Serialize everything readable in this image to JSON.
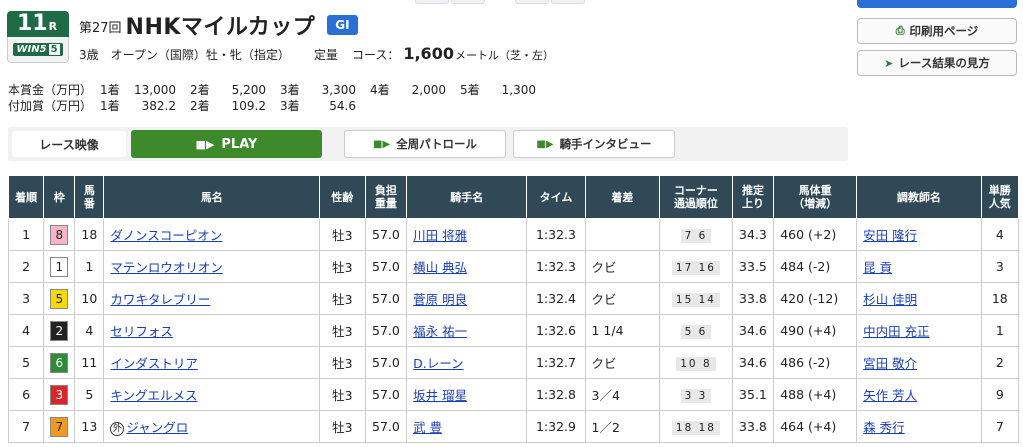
{
  "race": {
    "number": "11",
    "r_suffix": "R",
    "win5_label": "WIN",
    "win5_num": "5",
    "win5_leg": "5",
    "kai": "第27回",
    "name": "NHKマイルカップ",
    "grade": "GI",
    "conditions": "3歳　オープン（国際）牡・牝（指定）",
    "weight_rule": "定量",
    "course_label": "コース：",
    "distance": "1,600",
    "distance_unit": "メートル（芝・左）"
  },
  "buttons": {
    "print": "印刷用ページ",
    "results": "レース結果の見方",
    "print_icon": "printer-icon",
    "results_icon": "arrow-circle-icon"
  },
  "prize": {
    "main_label": "本賞金（万円）",
    "main": [
      [
        "1着",
        "13,000"
      ],
      [
        "2着",
        "5,200"
      ],
      [
        "3着",
        "3,300"
      ],
      [
        "4着",
        "2,000"
      ],
      [
        "5着",
        "1,300"
      ]
    ],
    "extra_label": "付加賞（万円）",
    "extra": [
      [
        "1着",
        "382.2"
      ],
      [
        "2着",
        "109.2"
      ],
      [
        "3着",
        "54.6"
      ]
    ]
  },
  "video": {
    "label": "レース映像",
    "play": "PLAY",
    "patrol": "全周パトロール",
    "interview": "騎手インタビュー"
  },
  "table": {
    "headers": [
      "着順",
      "枠",
      "馬番",
      "馬名",
      "性齢",
      "負担重量",
      "騎手名",
      "タイム",
      "着差",
      "コーナー通過順位",
      "推定上り",
      "馬体重（増減）",
      "調教師名",
      "単勝人気"
    ],
    "rows": [
      {
        "pos": "1",
        "waku": "8",
        "num": "18",
        "horse": "ダノンスコーピオン",
        "mark": "",
        "sex": "牡3",
        "wt": "57.0",
        "jockey": "川田 将雅",
        "time": "1:32.3",
        "margin": "",
        "corner": "7 6",
        "last": "34.3",
        "body": "460 (+2)",
        "trainer": "安田 隆行",
        "pop": "4"
      },
      {
        "pos": "2",
        "waku": "1",
        "num": "1",
        "horse": "マテンロウオリオン",
        "mark": "",
        "sex": "牡3",
        "wt": "57.0",
        "jockey": "横山 典弘",
        "time": "1:32.3",
        "margin": "クビ",
        "corner": "17 16",
        "last": "33.5",
        "body": "484 (-2)",
        "trainer": "昆 貢",
        "pop": "3"
      },
      {
        "pos": "3",
        "waku": "5",
        "num": "10",
        "horse": "カワキタレブリー",
        "mark": "",
        "sex": "牡3",
        "wt": "57.0",
        "jockey": "菅原 明良",
        "time": "1:32.4",
        "margin": "クビ",
        "corner": "15 14",
        "last": "33.8",
        "body": "420 (-12)",
        "trainer": "杉山 佳明",
        "pop": "18"
      },
      {
        "pos": "4",
        "waku": "2",
        "num": "4",
        "horse": "セリフォス",
        "mark": "",
        "sex": "牡3",
        "wt": "57.0",
        "jockey": "福永 祐一",
        "time": "1:32.6",
        "margin": "1 1/4",
        "corner": "5 6",
        "last": "34.6",
        "body": "490 (+4)",
        "trainer": "中内田 充正",
        "pop": "1"
      },
      {
        "pos": "5",
        "waku": "6",
        "num": "11",
        "horse": "インダストリア",
        "mark": "",
        "sex": "牡3",
        "wt": "57.0",
        "jockey": "D.レーン",
        "time": "1:32.7",
        "margin": "クビ",
        "corner": "10 8",
        "last": "34.6",
        "body": "486 (-2)",
        "trainer": "宮田 敬介",
        "pop": "2"
      },
      {
        "pos": "6",
        "waku": "3",
        "num": "5",
        "horse": "キングエルメス",
        "mark": "",
        "sex": "牡3",
        "wt": "57.0",
        "jockey": "坂井 瑠星",
        "time": "1:32.8",
        "margin": "3／4",
        "corner": "3 3",
        "last": "35.1",
        "body": "488 (+4)",
        "trainer": "矢作 芳人",
        "pop": "9"
      },
      {
        "pos": "7",
        "waku": "7",
        "num": "13",
        "horse": "ジャングロ",
        "mark": "外",
        "sex": "牡3",
        "wt": "57.0",
        "jockey": "武 豊",
        "time": "1:32.9",
        "margin": "1／2",
        "corner": "18 18",
        "last": "33.8",
        "body": "464 (+4)",
        "trainer": "森 秀行",
        "pop": "7"
      }
    ]
  },
  "waku_colors": {
    "1": [
      "#ffffff",
      "#222222"
    ],
    "2": [
      "#222222",
      "#ffffff"
    ],
    "3": [
      "#d62828",
      "#ffffff"
    ],
    "4": [
      "#1e5bc6",
      "#ffffff"
    ],
    "5": [
      "#f5d90a",
      "#222222"
    ],
    "6": [
      "#2e8b3a",
      "#ffffff"
    ],
    "7": [
      "#f29a1f",
      "#222222"
    ],
    "8": [
      "#f7b6c8",
      "#222222"
    ]
  }
}
